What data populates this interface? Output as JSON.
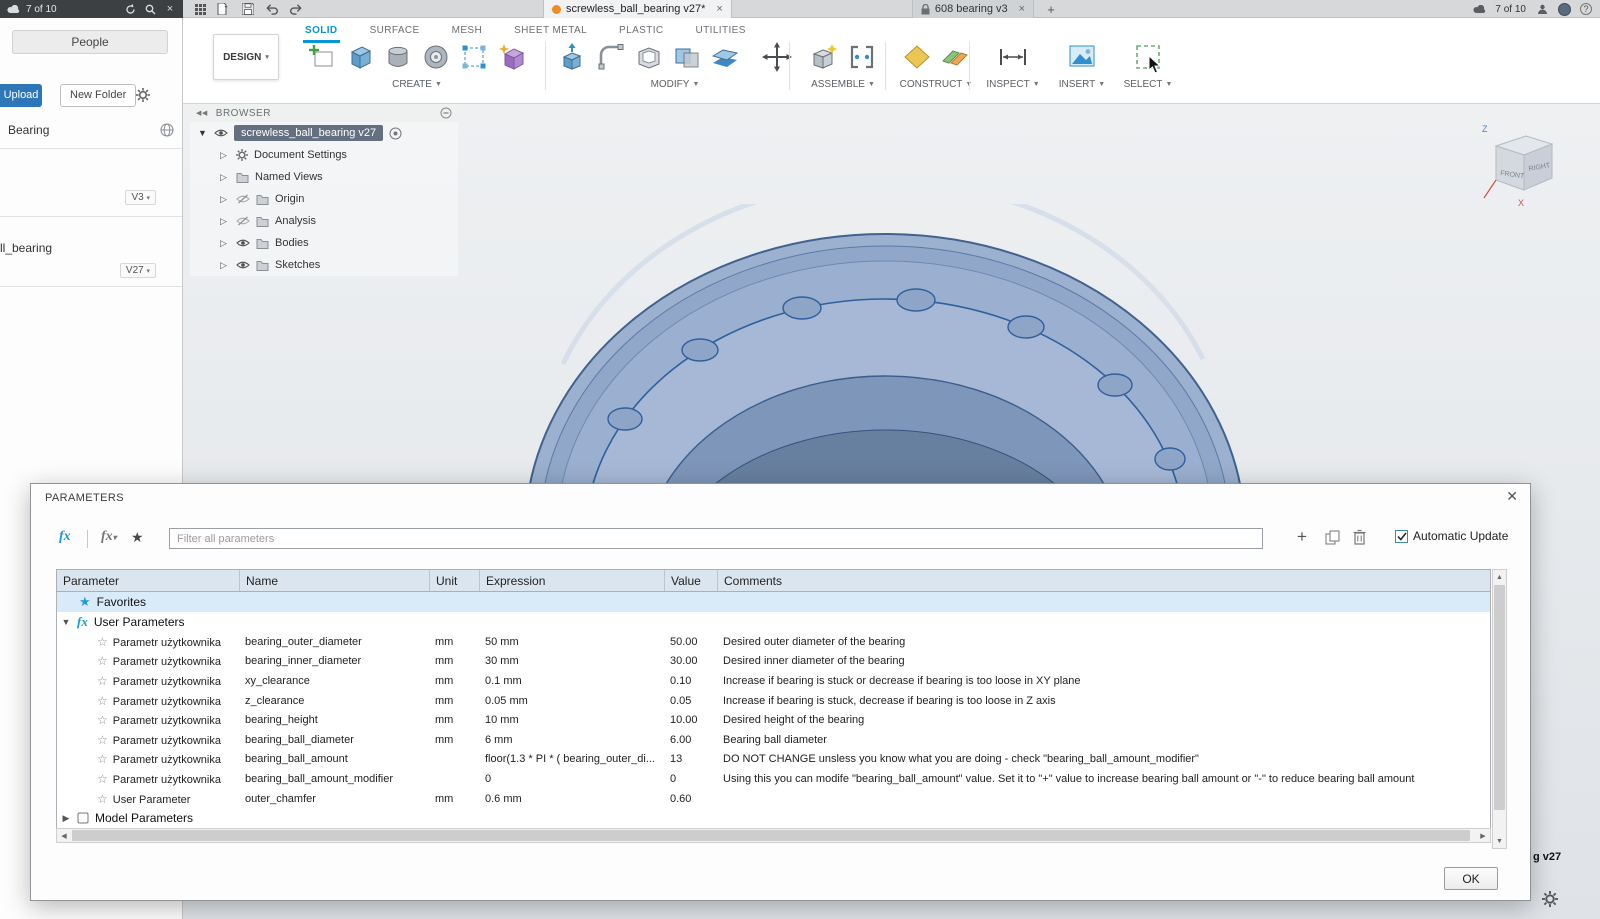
{
  "titlebar": {
    "project_status": "7 of 10",
    "tabs": [
      {
        "label": "screwless_ball_bearing v27*"
      },
      {
        "label": "608 bearing v3"
      }
    ],
    "account_status": "7 of 10"
  },
  "data_panel": {
    "people_tab": "People",
    "upload": "Upload",
    "new_folder": "New Folder",
    "project": "Bearing",
    "item1_version": "V3",
    "item2_title": "ll_bearing",
    "item2_version": "V27"
  },
  "ribbon": {
    "design": "DESIGN",
    "tabs": [
      "SOLID",
      "SURFACE",
      "MESH",
      "SHEET METAL",
      "PLASTIC",
      "UTILITIES"
    ],
    "groups": [
      "CREATE",
      "MODIFY",
      "ASSEMBLE",
      "CONSTRUCT",
      "INSPECT",
      "INSERT",
      "SELECT"
    ]
  },
  "browser": {
    "title": "BROWSER",
    "root": "screwless_ball_bearing v27",
    "items": [
      {
        "label": "Document Settings"
      },
      {
        "label": "Named Views"
      },
      {
        "label": "Origin"
      },
      {
        "label": "Analysis"
      },
      {
        "label": "Bodies"
      },
      {
        "label": "Sketches"
      }
    ]
  },
  "viewcube": {
    "front": "FRONT",
    "right": "RIGHT",
    "x": "X",
    "z": "Z"
  },
  "dialog": {
    "title": "PARAMETERS",
    "filter_placeholder": "Filter all parameters",
    "auto_update": "Automatic Update",
    "columns": [
      "Parameter",
      "Name",
      "Unit",
      "Expression",
      "Value",
      "Comments"
    ],
    "groups": {
      "favorites": "Favorites",
      "user": "User Parameters",
      "model": "Model Parameters"
    },
    "rows": [
      {
        "type": "Parametr użytkownika",
        "name": "bearing_outer_diameter",
        "unit": "mm",
        "expression": "50 mm",
        "value": "50.00",
        "comments": "Desired outer diameter of the bearing"
      },
      {
        "type": "Parametr użytkownika",
        "name": "bearing_inner_diameter",
        "unit": "mm",
        "expression": "30 mm",
        "value": "30.00",
        "comments": "Desired inner diameter of the bearing"
      },
      {
        "type": "Parametr użytkownika",
        "name": "xy_clearance",
        "unit": "mm",
        "expression": "0.1 mm",
        "value": "0.10",
        "comments": "Increase if bearing is stuck or decrease if bearing is too loose in XY plane"
      },
      {
        "type": "Parametr użytkownika",
        "name": "z_clearance",
        "unit": "mm",
        "expression": "0.05 mm",
        "value": "0.05",
        "comments": "Increase if bearing is stuck, decrease if bearing is too loose in Z axis"
      },
      {
        "type": "Parametr użytkownika",
        "name": "bearing_height",
        "unit": "mm",
        "expression": "10 mm",
        "value": "10.00",
        "comments": "Desired height of the bearing"
      },
      {
        "type": "Parametr użytkownika",
        "name": "bearing_ball_diameter",
        "unit": "mm",
        "expression": "6 mm",
        "value": "6.00",
        "comments": "Bearing ball diameter"
      },
      {
        "type": "Parametr użytkownika",
        "name": "bearing_ball_amount",
        "unit": "",
        "expression": "floor(1.3 * PI * ( bearing_outer_di...",
        "value": "13",
        "comments": "DO NOT CHANGE unsless you know what you are doing - check \"bearing_ball_amount_modifier\""
      },
      {
        "type": "Parametr użytkownika",
        "name": "bearing_ball_amount_modifier",
        "unit": "",
        "expression": "0",
        "value": "0",
        "comments": "Using this you can modife \"bearing_ball_amount\" value. Set it to \"+\" value to increase bearing ball amount or \"-\" to reduce bearing ball amount"
      },
      {
        "type": "User Parameter",
        "name": "outer_chamfer",
        "unit": "mm",
        "expression": "0.6 mm",
        "value": "0.60",
        "comments": ""
      }
    ],
    "ok": "OK"
  },
  "statusbar": {
    "doc": "g v27"
  }
}
